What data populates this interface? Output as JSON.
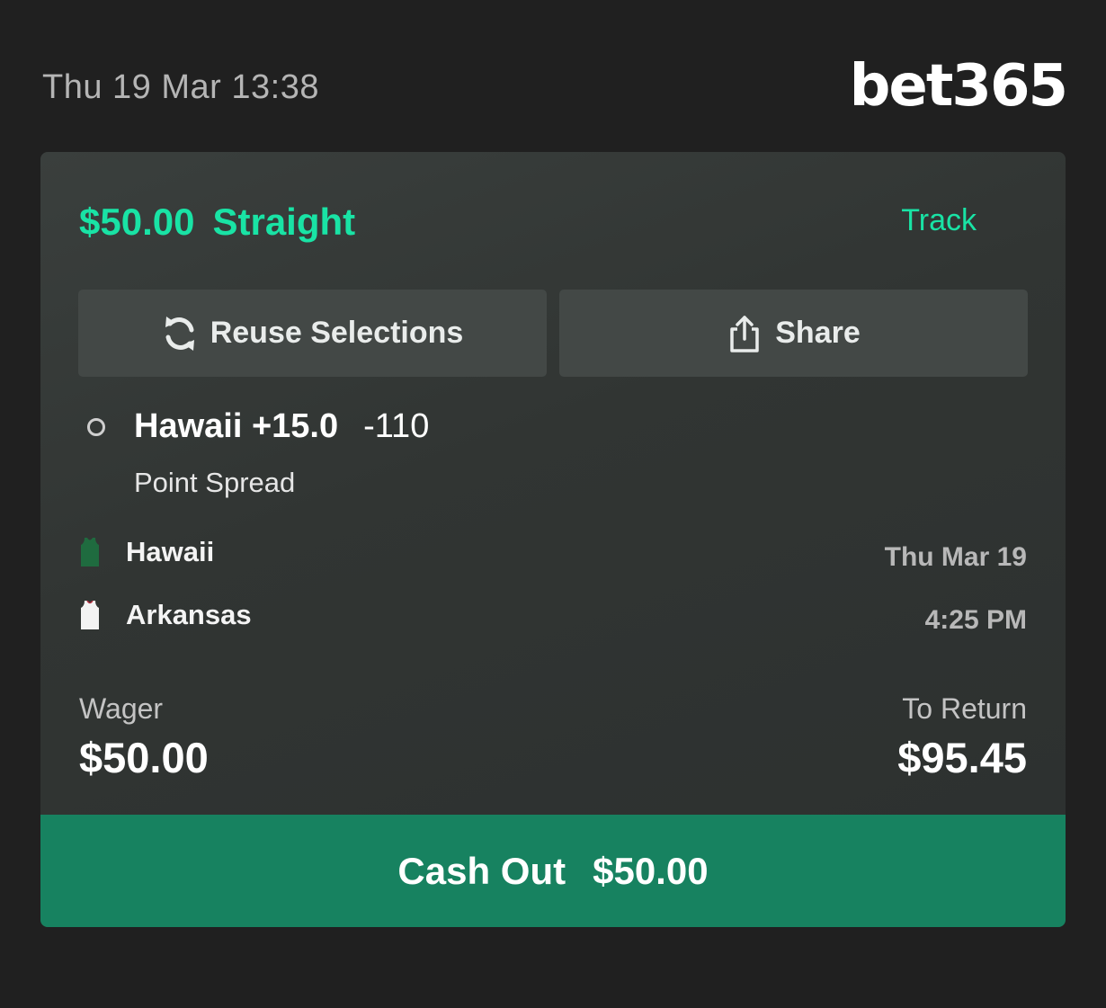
{
  "header": {
    "timestamp": "Thu 19 Mar 13:38",
    "brand": "bet365"
  },
  "bet": {
    "stake": "$50.00",
    "type": "Straight",
    "track_label": "Track",
    "actions": {
      "reuse_label": "Reuse Selections",
      "share_label": "Share"
    },
    "selection": {
      "name": "Hawaii +15.0",
      "odds": "-110",
      "market": "Point Spread"
    },
    "event": {
      "teams": [
        {
          "name": "Hawaii",
          "jersey_color": "#1f6b3f"
        },
        {
          "name": "Arkansas",
          "jersey_color": "#f3f3f3"
        }
      ],
      "date": "Thu Mar 19",
      "time": "4:25 PM"
    },
    "wager_label": "Wager",
    "wager_value": "$50.00",
    "return_label": "To Return",
    "return_value": "$95.45",
    "cashout": {
      "label": "Cash Out",
      "amount": "$50.00"
    }
  },
  "colors": {
    "accent": "#19e3a5",
    "cashout_bg": "#178260",
    "page_bg": "#202020",
    "card_bg": "#353a38"
  },
  "icons": {
    "reuse": "refresh-icon",
    "share": "share-icon",
    "selection": "open-circle-icon"
  }
}
